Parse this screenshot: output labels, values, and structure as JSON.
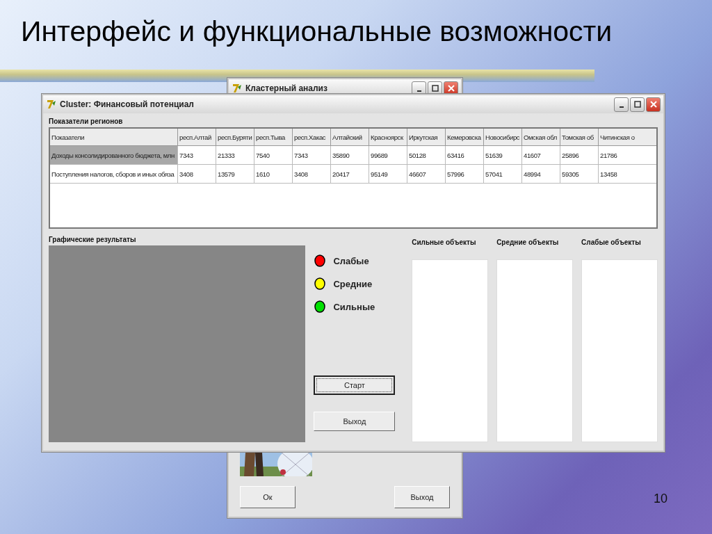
{
  "slide": {
    "title": "Интерфейс и функциональные возможности",
    "page_number": "10"
  },
  "back_window": {
    "title": "Кластерный анализ",
    "picture": {
      "kind": "picture"
    },
    "buttons": [
      "Ок",
      "Выход"
    ]
  },
  "main_window": {
    "title": "Cluster: Финансовый потенциал",
    "table": {
      "title": "Показатели регионов",
      "columns": [
        "Показатели",
        "респ.Алтай",
        "респ.Буряти",
        "респ.Тыва",
        "респ.Хакас",
        "Алтайский",
        "Красноярск",
        "Иркутская",
        "Кемеровска",
        "Новосибирс",
        "Омская обл",
        "Томская об",
        "Читинская о"
      ],
      "rows": [
        {
          "selected": true,
          "cells": [
            "Доходы консолидированного бюджета, млн",
            "7343",
            "21333",
            "7540",
            "7343",
            "35890",
            "99689",
            "50128",
            "63416",
            "51639",
            "41607",
            "25896",
            "21786"
          ]
        },
        {
          "selected": false,
          "cells": [
            "Поступления налогов, сборов и иных обяза",
            "3408",
            "13579",
            "1610",
            "3408",
            "20417",
            "95149",
            "46607",
            "57996",
            "57041",
            "48994",
            "59305",
            "13458"
          ]
        }
      ]
    },
    "graph_title": "Графические результаты",
    "legend": [
      {
        "label": "Слабые",
        "color": "#ff0000"
      },
      {
        "label": "Средние",
        "color": "#ffff00"
      },
      {
        "label": "Сильные",
        "color": "#00e000"
      }
    ],
    "buttons": [
      {
        "label": "Старт",
        "focused": true
      },
      {
        "label": "Выход",
        "focused": false
      }
    ],
    "lists": [
      {
        "title": "Сильные объекты"
      },
      {
        "title": "Средние объекты"
      },
      {
        "title": "Слабые объекты"
      }
    ]
  }
}
